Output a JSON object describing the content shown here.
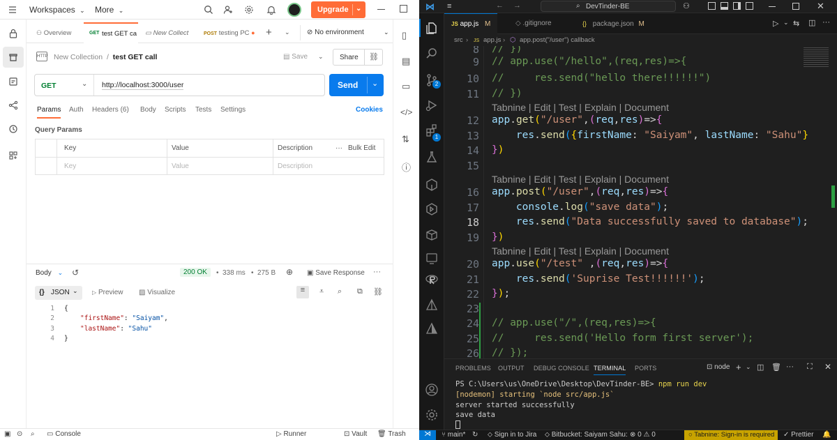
{
  "postman": {
    "topbar": {
      "workspaces": "Workspaces",
      "more": "More",
      "upgrade": "Upgrade"
    },
    "tabs": [
      {
        "label": "Overview"
      },
      {
        "method": "GET",
        "label": "test GET ca"
      },
      {
        "label": "New Collect"
      },
      {
        "method": "POST",
        "label": "testing PC"
      }
    ],
    "environment": "No environment",
    "breadcrumb": {
      "collection": "New Collection",
      "separator": "/",
      "request": "test GET call"
    },
    "save_label": "Save",
    "share_label": "Share",
    "request": {
      "method": "GET",
      "url": "http://localhost:3000/user",
      "send_label": "Send"
    },
    "subtabs": [
      "Params",
      "Auth",
      "Headers (6)",
      "Body",
      "Scripts",
      "Tests",
      "Settings"
    ],
    "cookies": "Cookies",
    "query_params": {
      "title": "Query Params",
      "headers": [
        "Key",
        "Value",
        "Description"
      ],
      "bulk_edit": "Bulk Edit",
      "placeholders": [
        "Key",
        "Value",
        "Description"
      ]
    },
    "response": {
      "body_label": "Body",
      "status": "200 OK",
      "time": "338 ms",
      "size": "275 B",
      "save_response": "Save Response",
      "format": "JSON",
      "preview": "Preview",
      "visualize": "Visualize",
      "lines": [
        {
          "n": "1",
          "text": "{"
        },
        {
          "n": "2",
          "key": "\"firstName\"",
          "sep": ": ",
          "val": "\"Saiyam\"",
          "end": ","
        },
        {
          "n": "3",
          "key": "\"lastName\"",
          "sep": ": ",
          "val": "\"Sahu\"",
          "end": ""
        },
        {
          "n": "4",
          "text": "}"
        }
      ]
    },
    "statusbar": {
      "console": "Console",
      "runner": "Runner",
      "vault": "Vault",
      "trash": "Trash"
    }
  },
  "vscode": {
    "search": "DevTinder-BE",
    "tabs": [
      {
        "icon": "JS",
        "label": "app.js",
        "badge": "M"
      },
      {
        "label": ".gitignore"
      },
      {
        "icon": "{}",
        "label": "package.json",
        "badge": "M"
      }
    ],
    "breadcrumb": [
      "src",
      "app.js",
      "app.post(\"/user\") callback"
    ],
    "badges": {
      "scm": "2",
      "extensions": "1"
    },
    "codelens": "Tabnine | Edit | Test | Explain | Document",
    "code_lines": [
      {
        "n": "8",
        "text": "// })"
      },
      {
        "n": "9",
        "text": "// app.use(\"/hello\",(req,res)=>{"
      },
      {
        "n": "10",
        "text": "//     res.send(\"hello there!!!!!!\")"
      },
      {
        "n": "11",
        "text": "// })"
      },
      {
        "n": "12",
        "text": "app.get(\"/user\",(req,res)=>{"
      },
      {
        "n": "13",
        "text": "    res.send({firstName: \"Saiyam\", lastName: \"Sahu\"}"
      },
      {
        "n": "14",
        "text": "})"
      },
      {
        "n": "15",
        "text": ""
      },
      {
        "n": "16",
        "text": "app.post(\"/user\",(req,res)=>{"
      },
      {
        "n": "17",
        "text": "    console.log(\"save data\");"
      },
      {
        "n": "18",
        "text": "    res.send(\"Data successfully saved to database\");"
      },
      {
        "n": "19",
        "text": "})"
      },
      {
        "n": "20",
        "text": "app.use(\"/test\" ,(req,res)=>{"
      },
      {
        "n": "21",
        "text": "    res.send('Suprise Test!!!!!!');"
      },
      {
        "n": "22",
        "text": "});"
      },
      {
        "n": "23",
        "text": ""
      },
      {
        "n": "24",
        "text": "// app.use(\"/\",(req,res)=>{"
      },
      {
        "n": "25",
        "text": "//     res.send('Hello form first server');"
      },
      {
        "n": "26",
        "text": "// });"
      }
    ],
    "panel_tabs": [
      "PROBLEMS",
      "OUTPUT",
      "DEBUG CONSOLE",
      "TERMINAL",
      "PORTS"
    ],
    "terminal_name": "node",
    "terminal": {
      "prompt": "PS C:\\Users\\us\\OneDrive\\Desktop\\DevTinder-BE>",
      "command": "npm run dev",
      "line2": "[nodemon] starting `node src/app.js`",
      "line3": "server started successfully",
      "line4": "save data"
    },
    "statusbar": {
      "branch": "main*",
      "jira": "Sign in to Jira",
      "bitbucket": "Bitbucket: Saiyam Sahu:",
      "errors": "0",
      "warnings": "0",
      "tabnine": "Tabnine: Sign-in is required",
      "prettier": "Prettier"
    }
  },
  "colors": {
    "postman_orange": "#ff6c37",
    "postman_blue": "#097bed",
    "status_green": "#007f31",
    "vscode_bg": "#1f1f1f",
    "tabnine_bg": "#c8a300"
  }
}
